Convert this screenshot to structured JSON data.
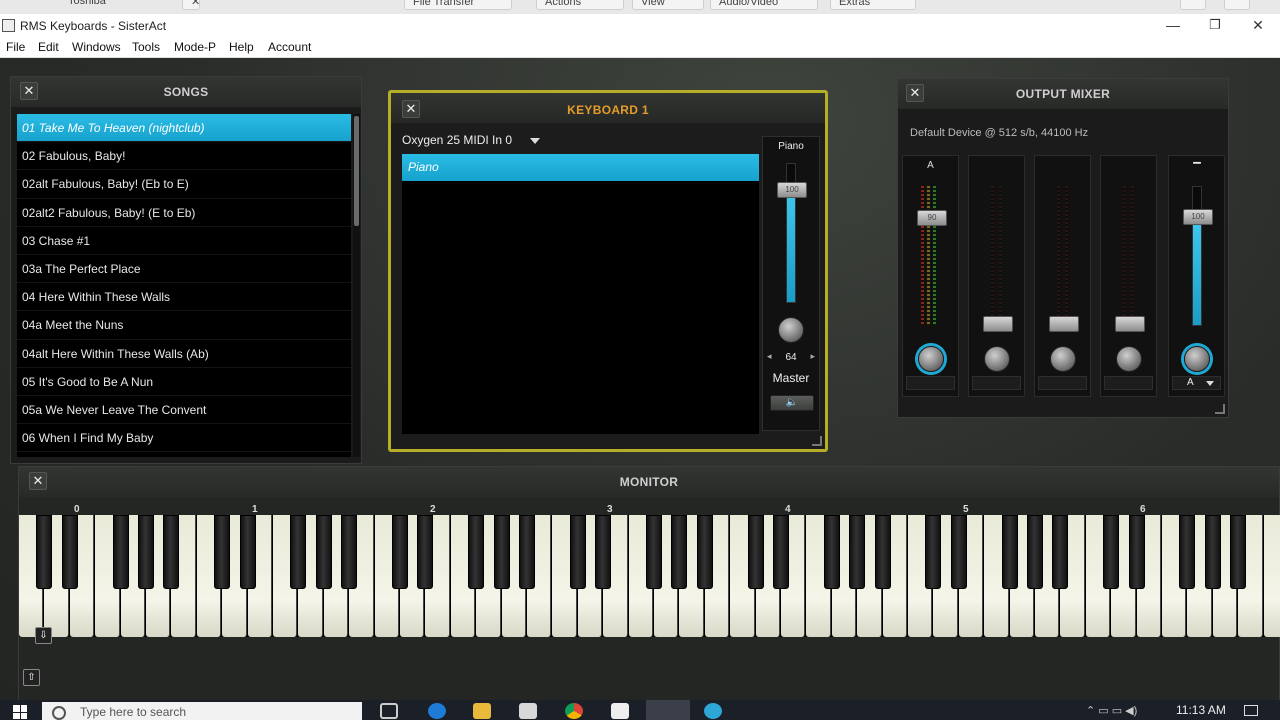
{
  "remote_toolbar": {
    "items": [
      "Toshiba",
      "File Transfer",
      "Actions",
      "View",
      "Audio/Video",
      "Extras"
    ]
  },
  "window": {
    "title": "RMS Keyboards - SisterAct",
    "minimize": "—",
    "restore": "❐",
    "close": "✕"
  },
  "menu": {
    "items": [
      "File",
      "Edit",
      "Windows",
      "Tools",
      "Mode-P",
      "Help",
      "Account"
    ]
  },
  "songs": {
    "title": "SONGS",
    "close": "✕",
    "items": [
      "01 Take Me To Heaven (nightclub)",
      "02 Fabulous, Baby!",
      "02alt Fabulous, Baby! (Eb to E)",
      "02alt2 Fabulous, Baby! (E to Eb)",
      "03 Chase #1",
      "03a The Perfect Place",
      "04 Here Within These Walls",
      "04a Meet the Nuns",
      "04alt Here Within These Walls (Ab)",
      "05 It's Good to Be A Nun",
      "05a We Never Leave The Convent",
      "06 When I Find My Baby"
    ]
  },
  "keyboard1": {
    "title": "KEYBOARD 1",
    "close": "✕",
    "midi_input": "Oxygen 25 MIDI In 0",
    "layers": [
      "Piano"
    ],
    "strip_label": "Piano",
    "fader_value": "100",
    "fader_level": 0.8,
    "pan_value": "64",
    "pan_left": "◂",
    "pan_right": "▸",
    "master_label": "Master",
    "speaker_icon": "🔈"
  },
  "output_mixer": {
    "title": "OUTPUT MIXER",
    "close": "✕",
    "device": "Default Device @ 512 s/b, 44100 Hz",
    "channels": [
      {
        "label": "A",
        "fader_value": "90"
      },
      {
        "label": "",
        "fader_value": ""
      },
      {
        "label": "",
        "fader_value": ""
      },
      {
        "label": "",
        "fader_value": ""
      }
    ],
    "master": {
      "label": "▪▪▪▪▪",
      "fader_value": "100",
      "fader_level": 0.75,
      "select": "A"
    }
  },
  "monitor": {
    "title": "MONITOR",
    "close": "✕",
    "octaves": [
      "0",
      "1",
      "2",
      "3",
      "4",
      "5",
      "6"
    ],
    "octave_down": "⇩",
    "octave_up": "⇧"
  },
  "taskbar": {
    "search_placeholder": "Type here to search",
    "clock": "11:13 AM"
  },
  "colors": {
    "accent": "#1faad6",
    "kb_border": "#b7ae28",
    "kb_title": "#e59c2a"
  }
}
